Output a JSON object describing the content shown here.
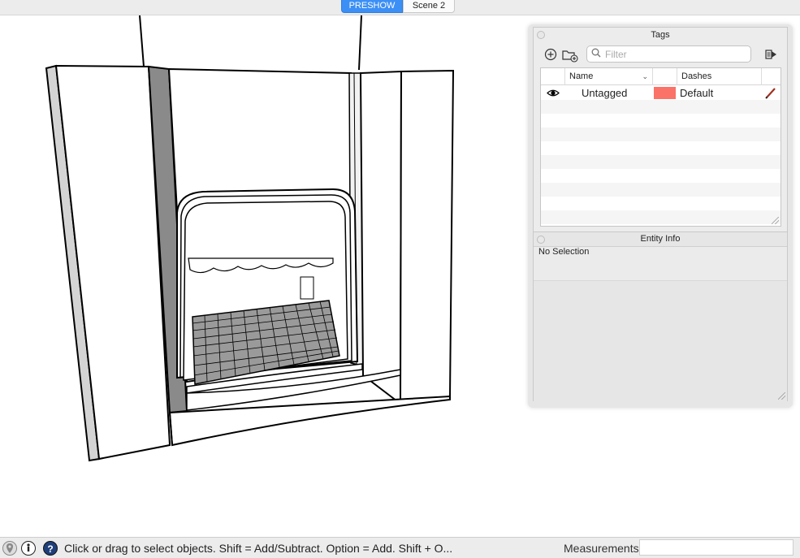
{
  "scenes": {
    "tabs": [
      {
        "label": "PRESHOW",
        "active": true
      },
      {
        "label": "Scene 2",
        "active": false
      }
    ],
    "active_color": "#3b8ff5"
  },
  "viewport": {
    "model_icon": "fireplace-stage-model"
  },
  "tags_panel": {
    "title": "Tags",
    "toolbar": {
      "add_tag_icon": "add-tag-icon",
      "add_folder_icon": "add-folder-icon",
      "details_icon": "details-arrow-icon"
    },
    "filter_placeholder": "Filter",
    "columns": {
      "name": "Name",
      "color": "",
      "dashes": "Dashes"
    },
    "rows": [
      {
        "name": "Untagged",
        "visible": true,
        "color": "#fa7268",
        "dashes": "Default"
      }
    ]
  },
  "entity_info": {
    "title": "Entity Info",
    "selection_text": "No Selection"
  },
  "status_bar": {
    "message": "Click or drag to select objects. Shift = Add/Subtract. Option = Add. Shift + O...",
    "measurements_label": "Measurements",
    "measurements_value": ""
  }
}
